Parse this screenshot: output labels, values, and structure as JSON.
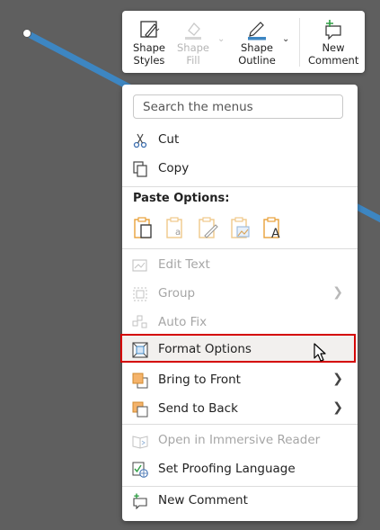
{
  "toolbar": {
    "shape_styles": "Shape Styles",
    "shape_fill": "Shape Fill",
    "shape_outline": "Shape Outline",
    "new_comment": "New Comment"
  },
  "menu": {
    "search_placeholder": "Search the menus",
    "cut": "Cut",
    "copy": "Copy",
    "paste_options": "Paste Options:",
    "edit_text": "Edit Text",
    "group": "Group",
    "auto_fix": "Auto Fix",
    "format_options": "Format Options",
    "bring_to_front": "Bring to Front",
    "send_to_back": "Send to Back",
    "immersive_reader": "Open in Immersive Reader",
    "proofing_language": "Set Proofing Language",
    "new_comment": "New Comment"
  },
  "colors": {
    "line": "#3d86c2",
    "highlight_border": "#d40000",
    "accent_orange": "#e8a13a"
  }
}
